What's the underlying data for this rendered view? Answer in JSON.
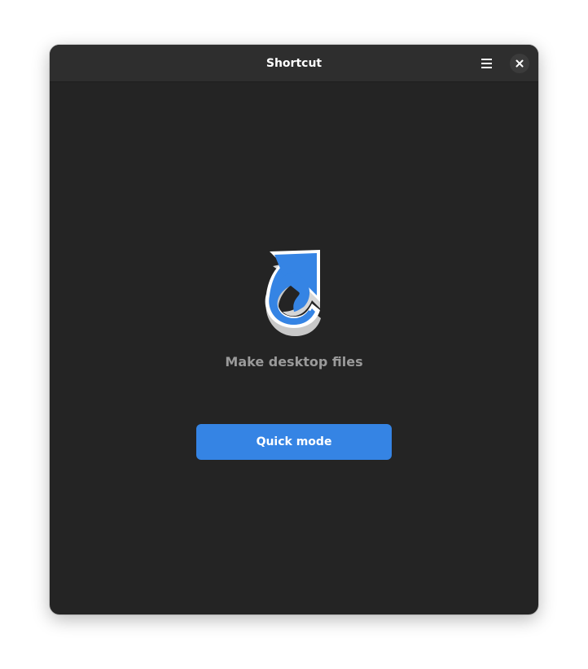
{
  "window": {
    "title": "Shortcut"
  },
  "header": {
    "menu_icon": "hamburger-menu-icon",
    "close_icon": "close-icon"
  },
  "main": {
    "app_icon": "shortcut-arrow-icon",
    "subtitle": "Make desktop files",
    "quick_mode_label": "Quick mode"
  },
  "colors": {
    "window_bg": "#242424",
    "headerbar_bg": "#2e2e2e",
    "accent": "#3584e4",
    "subtitle_text": "#9a9a9a",
    "close_button_bg": "#3b3b3b"
  }
}
